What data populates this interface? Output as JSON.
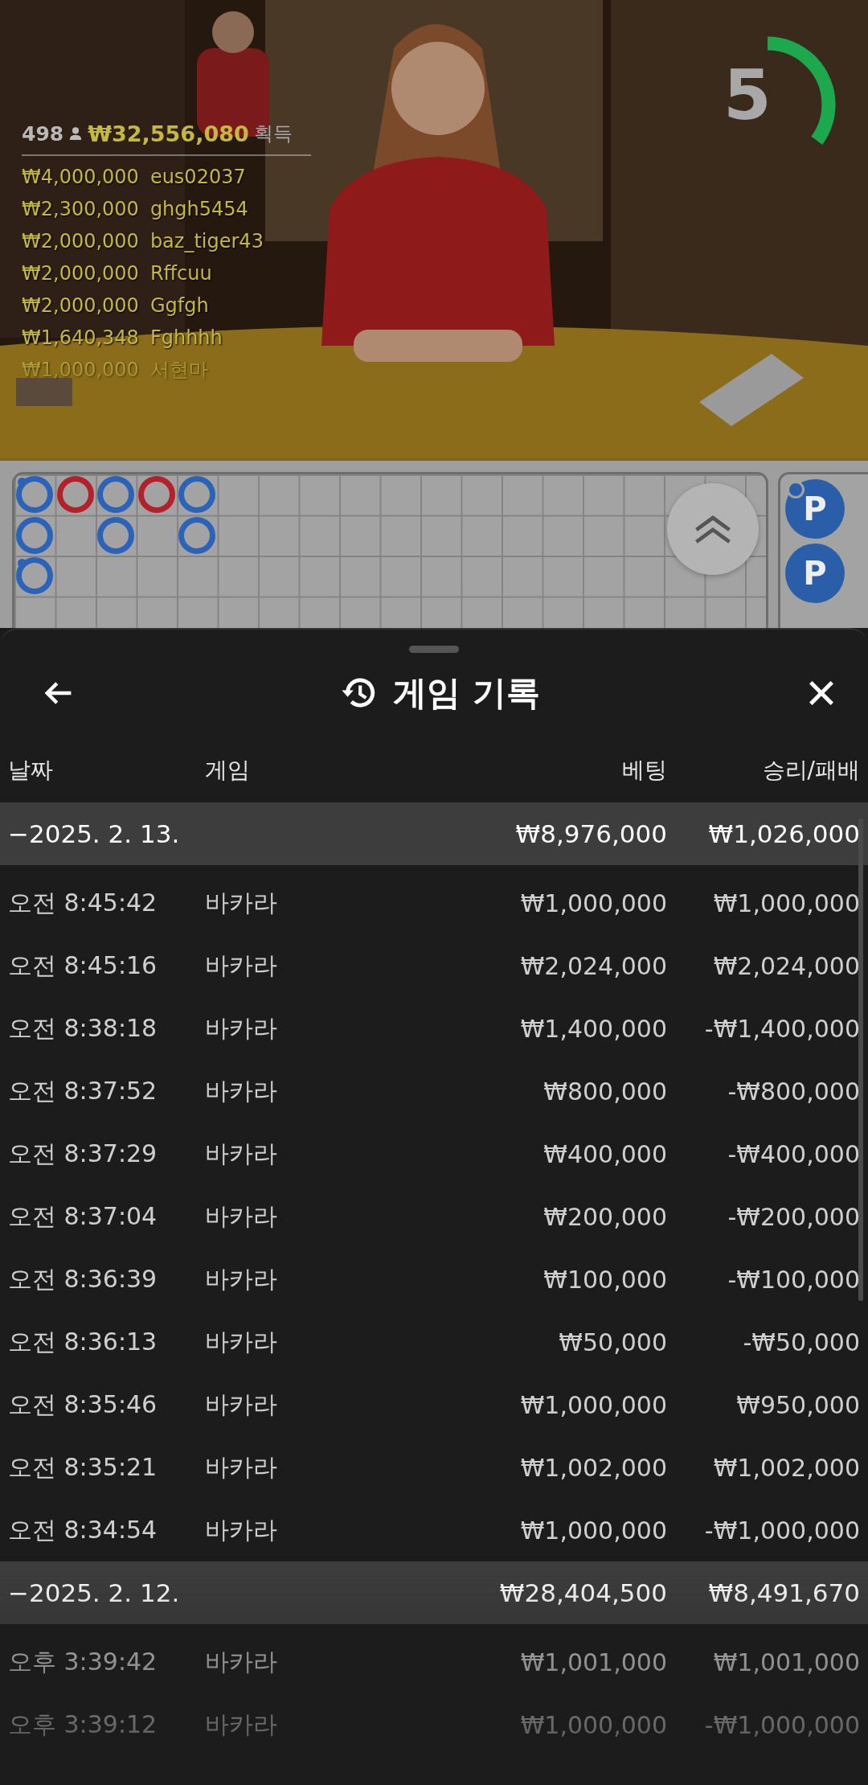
{
  "video": {
    "timer": {
      "value": "5",
      "level": 0.35
    },
    "player_count": "498",
    "total_won": "₩32,556,080",
    "total_label": "획득",
    "winners": [
      {
        "amount": "₩4,000,000",
        "name": "eus02037"
      },
      {
        "amount": "₩2,300,000",
        "name": "ghgh5454"
      },
      {
        "amount": "₩2,000,000",
        "name": "baz_tiger43"
      },
      {
        "amount": "₩2,000,000",
        "name": "Rffcuu"
      },
      {
        "amount": "₩2,000,000",
        "name": "Ggfgh"
      },
      {
        "amount": "₩1,640,348",
        "name": "Fghhhh"
      },
      {
        "amount": "₩1,000,000",
        "name": "서현마"
      }
    ]
  },
  "roadmap": {
    "big_road": [
      {
        "color": "#2b63b8",
        "marks": [
          {
            "dot": true
          },
          {
            "dot": false
          },
          {
            "dot": true
          }
        ]
      },
      {
        "color": "#b3222b",
        "marks": [
          {
            "dot": false
          }
        ]
      },
      {
        "color": "#2b63b8",
        "marks": [
          {
            "dot": false
          },
          {
            "dot": false
          }
        ]
      },
      {
        "color": "#b3222b",
        "marks": [
          {
            "dot": false
          }
        ]
      },
      {
        "color": "#2b63b8",
        "marks": [
          {
            "dot": false
          },
          {
            "dot": false
          }
        ]
      }
    ],
    "bead_plate": [
      {
        "label": "P",
        "color": "#2b5ea8",
        "dot": true
      },
      {
        "label": "P",
        "color": "#2b5ea8",
        "dot": false
      }
    ]
  },
  "sheet": {
    "title": "게임 기록",
    "columns": [
      "날짜",
      "게임",
      "베팅",
      "승리/패배"
    ],
    "groups": [
      {
        "date": "−2025. 2. 13.",
        "bet": "₩8,976,000",
        "result": "₩1,026,000",
        "rows": [
          {
            "time": "오전 8:45:42",
            "game": "바카라",
            "bet": "₩1,000,000",
            "result": "₩1,000,000"
          },
          {
            "time": "오전 8:45:16",
            "game": "바카라",
            "bet": "₩2,024,000",
            "result": "₩2,024,000"
          },
          {
            "time": "오전 8:38:18",
            "game": "바카라",
            "bet": "₩1,400,000",
            "result": "-₩1,400,000"
          },
          {
            "time": "오전 8:37:52",
            "game": "바카라",
            "bet": "₩800,000",
            "result": "-₩800,000"
          },
          {
            "time": "오전 8:37:29",
            "game": "바카라",
            "bet": "₩400,000",
            "result": "-₩400,000"
          },
          {
            "time": "오전 8:37:04",
            "game": "바카라",
            "bet": "₩200,000",
            "result": "-₩200,000"
          },
          {
            "time": "오전 8:36:39",
            "game": "바카라",
            "bet": "₩100,000",
            "result": "-₩100,000"
          },
          {
            "time": "오전 8:36:13",
            "game": "바카라",
            "bet": "₩50,000",
            "result": "-₩50,000"
          },
          {
            "time": "오전 8:35:46",
            "game": "바카라",
            "bet": "₩1,000,000",
            "result": "₩950,000"
          },
          {
            "time": "오전 8:35:21",
            "game": "바카라",
            "bet": "₩1,002,000",
            "result": "₩1,002,000"
          },
          {
            "time": "오전 8:34:54",
            "game": "바카라",
            "bet": "₩1,000,000",
            "result": "-₩1,000,000"
          }
        ]
      },
      {
        "date": "−2025. 2. 12.",
        "bet": "₩28,404,500",
        "result": "₩8,491,670",
        "rows": [
          {
            "time": "오후 3:39:42",
            "game": "바카라",
            "bet": "₩1,001,000",
            "result": "₩1,001,000"
          },
          {
            "time": "오후 3:39:12",
            "game": "바카라",
            "bet": "₩1,000,000",
            "result": "-₩1,000,000"
          }
        ]
      }
    ]
  }
}
